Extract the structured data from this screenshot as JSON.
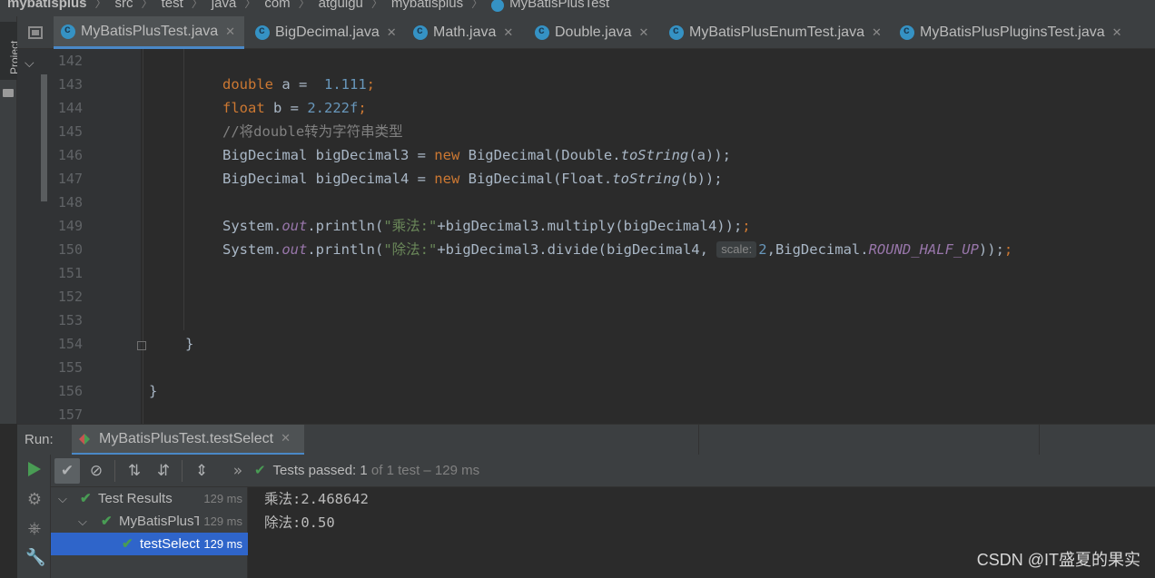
{
  "breadcrumb": [
    "mybatisplus",
    "src",
    "test",
    "java",
    "com",
    "atguigu",
    "mybatisplus",
    "MyBatisPlusTest"
  ],
  "left_strip": {
    "label": "Project"
  },
  "tabs": [
    {
      "label": "MyBatisPlusTest.java",
      "active": true
    },
    {
      "label": "BigDecimal.java",
      "active": false
    },
    {
      "label": "Math.java",
      "active": false
    },
    {
      "label": "Double.java",
      "active": false
    },
    {
      "label": "MyBatisPlusEnumTest.java",
      "active": false
    },
    {
      "label": "MyBatisPlusPluginsTest.java",
      "active": false
    }
  ],
  "editor": {
    "line_numbers": [
      "142",
      "143",
      "144",
      "145",
      "146",
      "147",
      "148",
      "149",
      "150",
      "151",
      "152",
      "153",
      "154",
      "155",
      "156",
      "157"
    ],
    "code": {
      "l143": {
        "kw": "double",
        "rest": " a =  ",
        "num": "1.111",
        "end": ";"
      },
      "l144": {
        "kw": "float",
        "rest": " b = ",
        "num": "2.222f",
        "end": ";"
      },
      "l145": {
        "comment": "//将double转为字符串类型"
      },
      "l146": {
        "a": "BigDecimal bigDecimal3 = ",
        "kw": "new",
        "b": " BigDecimal(Double.",
        "m": "toString",
        "c": "(a));"
      },
      "l147": {
        "a": "BigDecimal bigDecimal4 = ",
        "kw": "new",
        "b": " BigDecimal(Float.",
        "m": "toString",
        "c": "(b));"
      },
      "l149": {
        "a": "System.",
        "f": "out",
        "b": ".println(",
        "s": "\"乘法:\"",
        "c": "+bigDecimal3.multiply(bigDecimal4));"
      },
      "l150": {
        "a": "System.",
        "f": "out",
        "b": ".println(",
        "s": "\"除法:\"",
        "c": "+bigDecimal3.divide(bigDecimal4,",
        "hint": "scale:",
        "n": "2",
        "d": ",BigDecimal.",
        "f2": "ROUND_HALF_UP",
        "e": "));"
      },
      "l154": "}",
      "l156": "}"
    }
  },
  "run": {
    "label": "Run:",
    "tab_label": "MyBatisPlusTest.testSelect",
    "status": {
      "prefix": "Tests passed:",
      "count": "1",
      "suffix": "of 1 test – 129 ms"
    },
    "tree": [
      {
        "label": "Test Results",
        "time": "129 ms"
      },
      {
        "label": "MyBatisPlusTest",
        "time": "129 ms"
      },
      {
        "label": "testSelect",
        "time": "129 ms"
      }
    ],
    "console": [
      "乘法:2.468642",
      "除法:0.50"
    ]
  },
  "watermark": "CSDN @IT盛夏的果实",
  "colors": {
    "accent": "#4a88c7",
    "selection": "#2f65ca",
    "success": "#499c54",
    "keyword": "#cc7832"
  },
  "icons": [
    "project-structure-icon",
    "class-icon",
    "close-icon",
    "run-icon",
    "check-icon",
    "stop-icon",
    "sort-icon",
    "expand-icon",
    "wrench-icon"
  ]
}
